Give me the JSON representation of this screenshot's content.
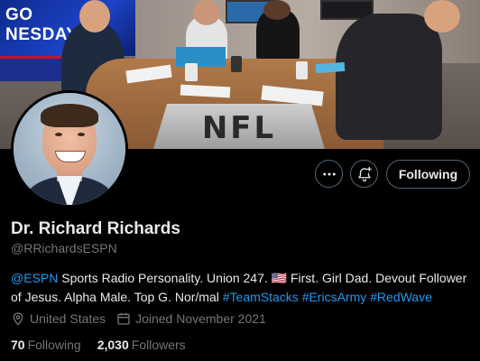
{
  "banner": {
    "screen_text": "GO\nNESDAY",
    "logo_text": "NFL"
  },
  "profile": {
    "name": "Dr. Richard Richards",
    "handle": "@RRichardsESPN",
    "bio": {
      "mention": "@ESPN",
      "text1": " Sports Radio Personality. Union 247. ",
      "flag": "🇺🇸",
      "text2": " First. Girl Dad. Devout Follower of Jesus. Alpha Male. Top G. Nor/mal ",
      "hashtags": [
        "#TeamStacks",
        "#EricsArmy",
        "#RedWave"
      ]
    },
    "location": "United States",
    "joined": "Joined November 2021",
    "following_count": "70",
    "following_label": "Following",
    "followers_count": "2,030",
    "followers_label": "Followers"
  },
  "actions": {
    "more_icon": "more-icon",
    "notify_icon": "bell-plus-icon",
    "follow_label": "Following"
  },
  "colors": {
    "accent": "#1d9bf0",
    "muted": "#71767b",
    "background": "#000000",
    "text": "#e7e9ea"
  }
}
